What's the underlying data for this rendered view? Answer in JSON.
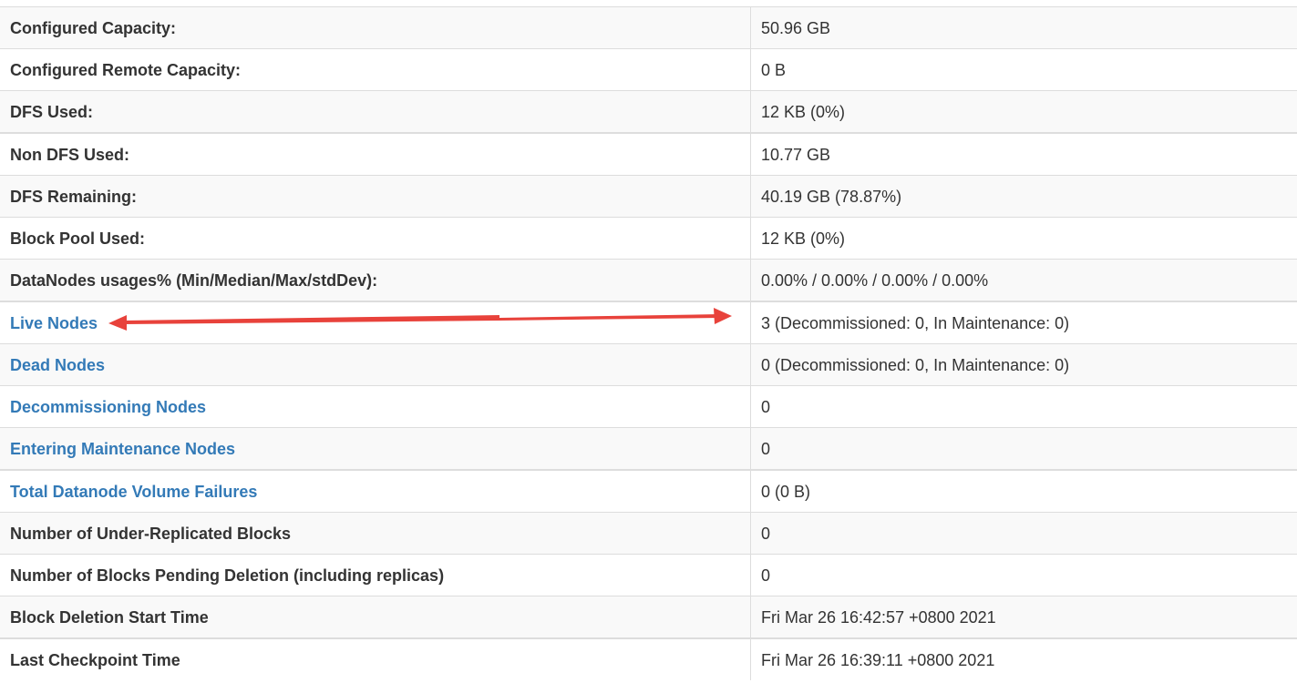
{
  "rows": [
    {
      "label": "Configured Capacity:",
      "value": "50.96 GB",
      "link": false
    },
    {
      "label": "Configured Remote Capacity:",
      "value": "0 B",
      "link": false
    },
    {
      "label": "DFS Used:",
      "value": "12 KB (0%)",
      "link": false
    },
    {
      "label": "Non DFS Used:",
      "value": "10.77 GB",
      "link": false
    },
    {
      "label": "DFS Remaining:",
      "value": "40.19 GB (78.87%)",
      "link": false
    },
    {
      "label": "Block Pool Used:",
      "value": "12 KB (0%)",
      "link": false
    },
    {
      "label": "DataNodes usages% (Min/Median/Max/stdDev):",
      "value": "0.00% / 0.00% / 0.00% / 0.00%",
      "link": false
    },
    {
      "label": "Live Nodes",
      "value": "3 (Decommissioned: 0, In Maintenance: 0)",
      "link": true
    },
    {
      "label": "Dead Nodes",
      "value": "0 (Decommissioned: 0, In Maintenance: 0)",
      "link": true
    },
    {
      "label": "Decommissioning Nodes",
      "value": "0",
      "link": true
    },
    {
      "label": "Entering Maintenance Nodes",
      "value": "0",
      "link": true
    },
    {
      "label": "Total Datanode Volume Failures",
      "value": "0 (0 B)",
      "link": true
    },
    {
      "label": "Number of Under-Replicated Blocks",
      "value": "0",
      "link": false
    },
    {
      "label": "Number of Blocks Pending Deletion (including replicas)",
      "value": "0",
      "link": false
    },
    {
      "label": "Block Deletion Start Time",
      "value": "Fri Mar 26 16:42:57 +0800 2021",
      "link": false
    },
    {
      "label": "Last Checkpoint Time",
      "value": "Fri Mar 26 16:39:11 +0800 2021",
      "link": false
    }
  ],
  "colors": {
    "link": "#337ab7",
    "text": "#333333",
    "stripe": "#f9f9f9",
    "border": "#dddddd",
    "annotation_arrow": "#e8423b"
  },
  "annotation": {
    "type": "double-headed-arrow",
    "color": "#e8423b"
  }
}
